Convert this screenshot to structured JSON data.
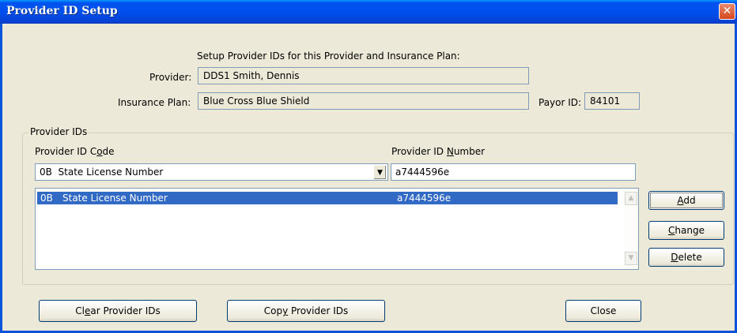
{
  "window": {
    "title": "Provider ID Setup",
    "close_glyph": "✕"
  },
  "header": {
    "intro": "Setup Provider IDs for this Provider and Insurance Plan:",
    "provider_label": "Provider:",
    "provider_value": "DDS1 Smith, Dennis",
    "plan_label": "Insurance Plan:",
    "plan_value": "Blue Cross Blue Shield",
    "payor_label": "Payor ID:",
    "payor_value": "84101"
  },
  "provider_ids": {
    "group_title": "Provider IDs",
    "code_label_a": "Provider ID C",
    "code_label_u": "o",
    "code_label_b": "de",
    "number_label_a": "Provider ID ",
    "number_label_u": "N",
    "number_label_b": "umber",
    "code_selected_code": "0B",
    "code_selected_desc": "State License Number",
    "number_value": "a7444596e",
    "list": [
      {
        "code": "0B",
        "description": "State License Number",
        "number": "a7444596e"
      }
    ]
  },
  "buttons": {
    "add_u": "A",
    "add_rest": "dd",
    "change_u": "C",
    "change_rest": "hange",
    "delete_u": "D",
    "delete_rest": "elete",
    "clear_a": "Cl",
    "clear_u": "e",
    "clear_b": "ar Provider IDs",
    "copy_a": "Cop",
    "copy_u": "y",
    "copy_b": " Provider IDs",
    "close": "Close"
  },
  "icons": {
    "dropdown": "chevron-down-icon",
    "scroll_up": "scroll-up-icon",
    "scroll_down": "scroll-down-icon"
  }
}
